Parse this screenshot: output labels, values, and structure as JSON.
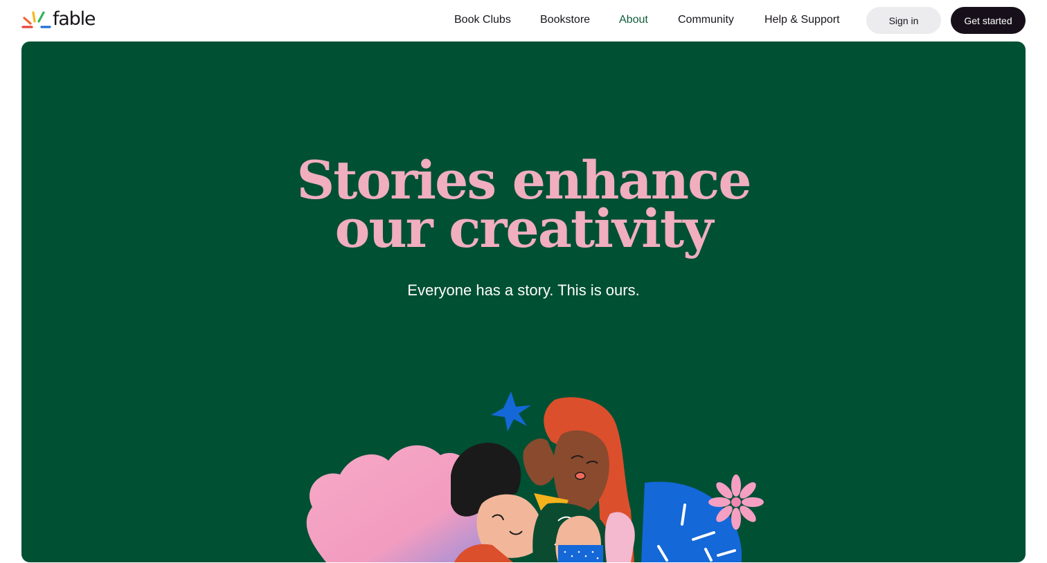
{
  "header": {
    "logo_text": "fable",
    "nav": [
      {
        "label": "Book Clubs",
        "active": false
      },
      {
        "label": "Bookstore",
        "active": false
      },
      {
        "label": "About",
        "active": true
      },
      {
        "label": "Community",
        "active": false
      },
      {
        "label": "Help & Support",
        "active": false
      }
    ],
    "sign_in_label": "Sign in",
    "get_started_label": "Get started"
  },
  "hero": {
    "title_line_1": "Stories enhance",
    "title_line_2": "our creativity",
    "subtitle": "Everyone has a story. This is ours."
  },
  "colors": {
    "hero_background": "#005034",
    "title_pink": "#f0aebf",
    "nav_active": "#0f5b3a",
    "primary_button": "#17101a",
    "secondary_button": "#ececee"
  },
  "icons": {
    "logo_mark": "colorful-rays-icon",
    "illustration": "people-reading-illustration"
  }
}
